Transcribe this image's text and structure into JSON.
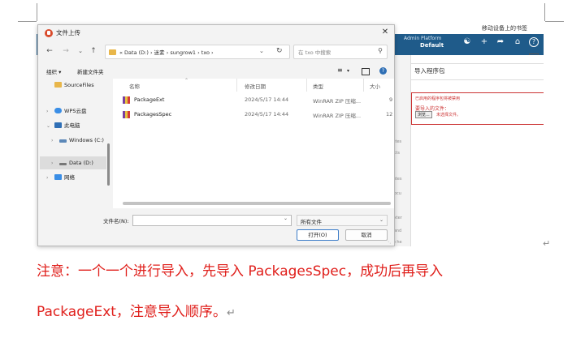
{
  "background_app": {
    "top_right_text": "移动设备上的书签",
    "brand_line": "Admin Platform",
    "brand_default": "Default",
    "panel_title": "导入程序包",
    "red_hint": "已启用的程序包将被禁用",
    "red_label": "要导入的文件：",
    "browse_label": "浏览...",
    "red_file_hint": "未选择文件。",
    "side_fragments": [
      "bjects",
      "cts",
      "ributes",
      "n docu",
      "d exter",
      "on and",
      "n to he",
      "nbutes"
    ]
  },
  "dialog": {
    "title": "文件上传",
    "close": "✕",
    "address_path": "« Data (D:)  ›  迷素  ›  sungrow1  ›  txo  ›",
    "search_placeholder": "在 txo 中搜索",
    "organize": "组织 ▾",
    "new_folder": "新建文件夹",
    "sidebar": [
      {
        "label": "SourceFiles",
        "chevron": "",
        "color": "#e8b64a"
      },
      {
        "label": "WPS云盘",
        "chevron": "›",
        "color": "#3a8ee6"
      },
      {
        "label": "此电脑",
        "chevron": "⌄",
        "color": "#2f6fb5"
      },
      {
        "label": "Windows (C:)",
        "chevron": "›",
        "color": "#5c88b8"
      },
      {
        "label": "Data (D:)",
        "chevron": "›",
        "color": "#777777"
      },
      {
        "label": "网络",
        "chevron": "›",
        "color": "#3a8ee6"
      }
    ],
    "columns": {
      "name": "名称",
      "modified": "修改日期",
      "type": "类型",
      "size": "大小"
    },
    "files": [
      {
        "name": "PackageExt",
        "modified": "2024/5/17 14:44",
        "type": "WinRAR ZIP 压缩...",
        "size": "9"
      },
      {
        "name": "PackagesSpec",
        "modified": "2024/5/17 14:44",
        "type": "WinRAR ZIP 压缩...",
        "size": "12"
      }
    ],
    "filename_label": "文件名(N):",
    "filename_value": "",
    "filetype_value": "所有文件",
    "open_label": "打开(O)",
    "cancel_label": "取消"
  },
  "document": {
    "note_line1": "注意：一个一个进行导入，先导入 PackagesSpec，成功后再导入",
    "note_line2": "PackageExt，注意导入顺序。",
    "para_mark": "↵"
  },
  "colors": {
    "header_blue": "#1f5b8a",
    "note_red": "#e0201c",
    "accent_blue": "#3c7cc8"
  }
}
